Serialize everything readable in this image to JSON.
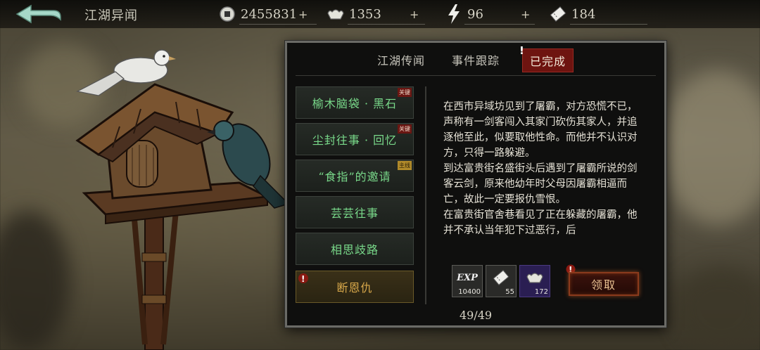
{
  "header": {
    "title": "江湖异闻",
    "resources": [
      {
        "icon": "coin-icon",
        "value": "2455831"
      },
      {
        "icon": "silver-ingot-icon",
        "value": "1353"
      },
      {
        "icon": "lightning-icon",
        "value": "96"
      },
      {
        "icon": "ticket-icon",
        "value": "184"
      }
    ],
    "plus": "+"
  },
  "panel": {
    "tabs": [
      {
        "label": "江湖传闻",
        "active": false
      },
      {
        "label": "事件跟踪",
        "active": false
      },
      {
        "label": "已完成",
        "active": true
      }
    ],
    "quests": [
      {
        "label": "榆木脑袋 · 黑石",
        "tag": "关键",
        "tag_type": "key"
      },
      {
        "label": "尘封往事 · 回忆",
        "tag": "关键",
        "tag_type": "key"
      },
      {
        "label": "“食指”的邀请",
        "tag": "主线",
        "tag_type": "main"
      },
      {
        "label": "芸芸往事",
        "tag": "",
        "tag_type": ""
      },
      {
        "label": "相思歧路",
        "tag": "",
        "tag_type": ""
      },
      {
        "label": "断恩仇",
        "tag": "",
        "tag_type": "",
        "selected": true
      }
    ],
    "description": "在西市异域坊见到了屠霸，对方恐慌不已，声称有一剑客闯入其家门砍伤其家人，并追逐他至此，似要取他性命。而他并不认识对方，只得一路躲避。\n到达富贵街名盛街头后遇到了屠霸所说的剑客云剑，原来他幼年时父母因屠霸相逼而亡，故此一定要报仇雪恨。\n在富贵街官舍巷看见了正在躲藏的屠霸，他并不承认当年犯下过恶行，后",
    "rewards": [
      {
        "icon": "exp-icon",
        "label": "EXP",
        "count": "10400"
      },
      {
        "icon": "ticket-icon",
        "count": "55"
      },
      {
        "icon": "silver-ingot-icon",
        "count": "172"
      }
    ],
    "claim_label": "领取",
    "page": "49/49"
  },
  "colors": {
    "active_tab": "#6e1410",
    "quest_text": "#79d98a",
    "selected_quest_text": "#d8a84a",
    "claim_glow": "#dc6428"
  }
}
